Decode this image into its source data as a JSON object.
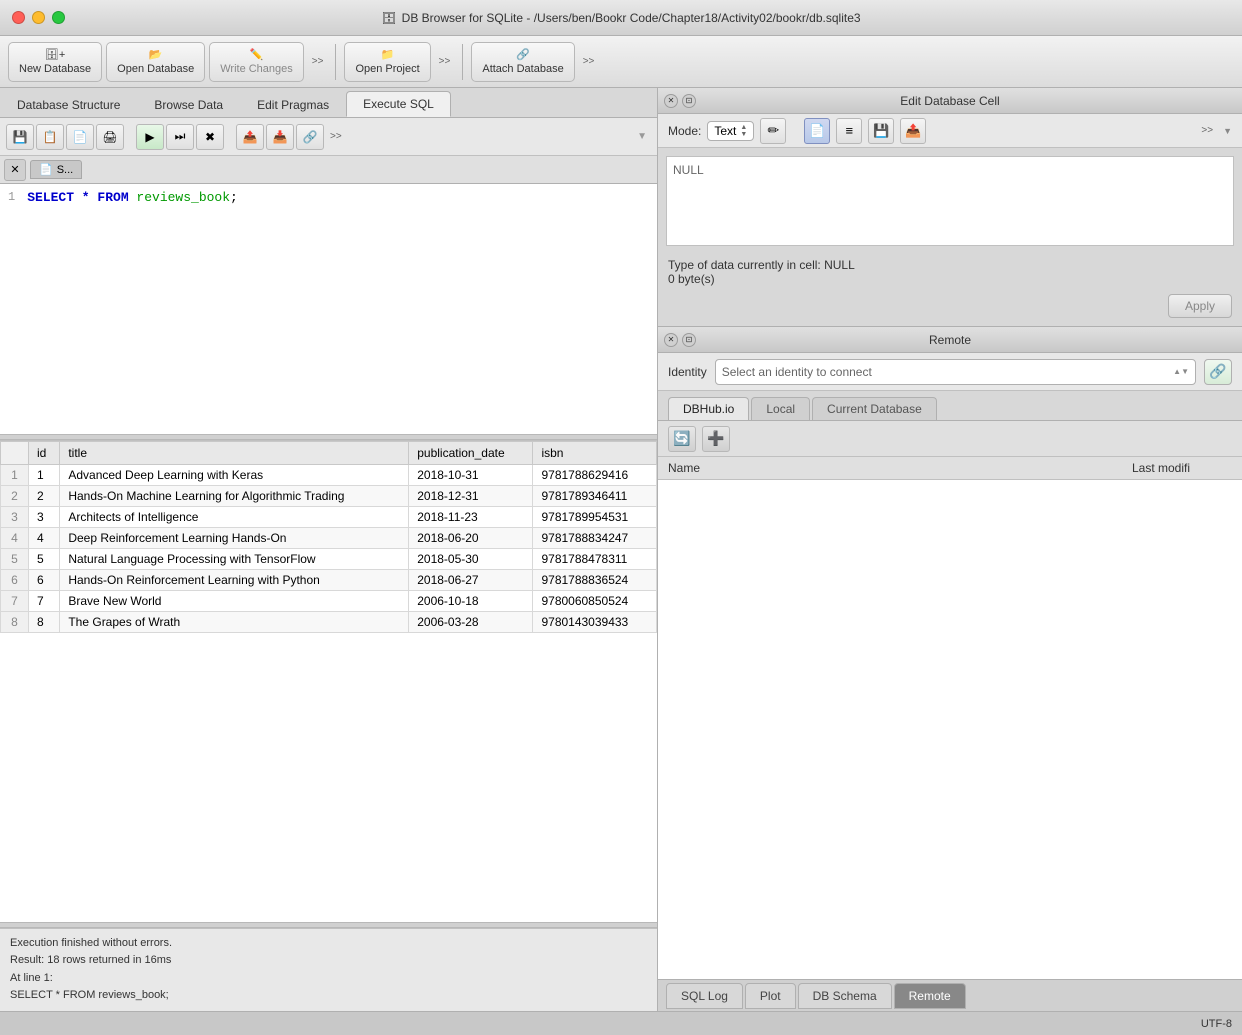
{
  "titlebar": {
    "title": "DB Browser for SQLite - /Users/ben/Bookr Code/Chapter18/Activity02/bookr/db.sqlite3",
    "db_icon": "🗄"
  },
  "toolbar": {
    "new_database": "New Database",
    "open_database": "Open Database",
    "write_changes": "Write Changes",
    "chevron1": ">>",
    "open_project": "Open Project",
    "chevron2": ">>",
    "attach_database": "Attach Database",
    "chevron3": ">>"
  },
  "tabs": {
    "database_structure": "Database Structure",
    "browse_data": "Browse Data",
    "edit_pragmas": "Edit Pragmas",
    "execute_sql": "Execute SQL"
  },
  "sql_toolbar": {
    "icons": [
      "💾",
      "📋",
      "📄",
      "🖨",
      "▶",
      "⏭",
      "✖",
      "📤",
      "📥",
      "🔗",
      ">>"
    ]
  },
  "file_tab": {
    "name": "S...",
    "icon": "📄"
  },
  "sql_editor": {
    "line1_number": "1",
    "line1_content": "SELECT * FROM reviews_book;"
  },
  "results": {
    "columns": [
      "id",
      "title",
      "publication_date",
      "isbn"
    ],
    "rows": [
      {
        "num": "1",
        "id": "1",
        "title": "Advanced Deep Learning with Keras",
        "date": "2018-10-31",
        "isbn": "9781788629416"
      },
      {
        "num": "2",
        "id": "2",
        "title": "Hands-On Machine Learning for Algorithmic Trading",
        "date": "2018-12-31",
        "isbn": "9781789346411"
      },
      {
        "num": "3",
        "id": "3",
        "title": "Architects of Intelligence",
        "date": "2018-11-23",
        "isbn": "9781789954531"
      },
      {
        "num": "4",
        "id": "4",
        "title": "Deep Reinforcement Learning Hands-On",
        "date": "2018-06-20",
        "isbn": "9781788834247"
      },
      {
        "num": "5",
        "id": "5",
        "title": "Natural Language Processing with TensorFlow",
        "date": "2018-05-30",
        "isbn": "9781788478311"
      },
      {
        "num": "6",
        "id": "6",
        "title": "Hands-On Reinforcement Learning with Python",
        "date": "2018-06-27",
        "isbn": "9781788836524"
      },
      {
        "num": "7",
        "id": "7",
        "title": "Brave New World",
        "date": "2006-10-18",
        "isbn": "9780060850524"
      },
      {
        "num": "8",
        "id": "8",
        "title": "The Grapes of Wrath",
        "date": "2006-03-28",
        "isbn": "9780143039433"
      }
    ]
  },
  "status": {
    "line1": "Execution finished without errors.",
    "line2": "Result: 18 rows returned in 16ms",
    "line3": "At line 1:",
    "line4": "SELECT * FROM reviews_book;"
  },
  "cell_editor": {
    "header": "Edit Database Cell",
    "mode_label": "Mode:",
    "mode_value": "Text",
    "null_text": "NULL",
    "type_info": "Type of data currently in cell: NULL",
    "size_info": "0 byte(s)",
    "apply_label": "Apply"
  },
  "remote_panel": {
    "header": "Remote",
    "identity_label": "Identity",
    "identity_placeholder": "Select an identity to connect",
    "tabs": {
      "dbhub": "DBHub.io",
      "local": "Local",
      "current_db": "Current Database"
    },
    "table_header": {
      "name": "Name",
      "modified": "Last modifi"
    }
  },
  "bottom_tabs": {
    "sql_log": "SQL Log",
    "plot": "Plot",
    "db_schema": "DB Schema",
    "remote": "Remote"
  },
  "footer": {
    "encoding": "UTF-8"
  }
}
